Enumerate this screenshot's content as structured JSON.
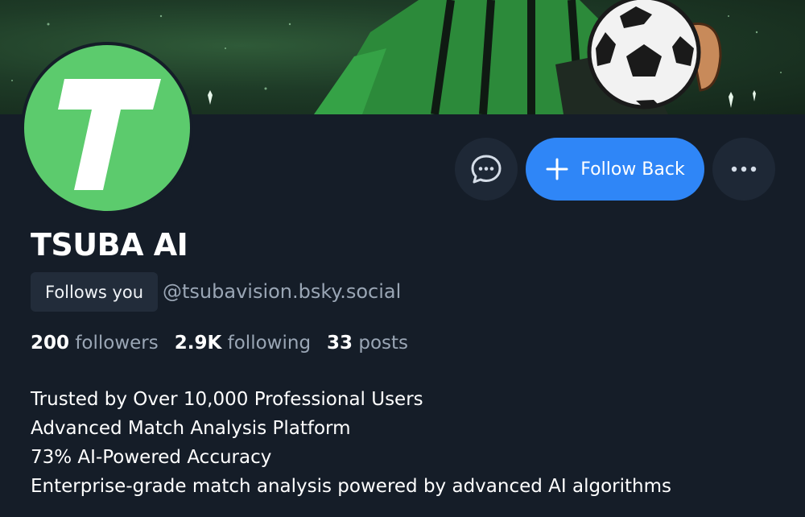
{
  "profile": {
    "display_name": "TSUBA AI",
    "avatar_letter": "T",
    "follows_you_label": "Follows you",
    "handle": "@tsubavision.bsky.social",
    "colors": {
      "avatar_bg": "#5ccb6d",
      "accent": "#2f86f7",
      "page_bg": "#151d28"
    }
  },
  "actions": {
    "message_icon": "chat-bubble-icon",
    "follow_back_label": "Follow Back",
    "follow_icon": "plus-icon",
    "more_icon": "ellipsis-icon"
  },
  "stats": [
    {
      "value": "200",
      "label": "followers"
    },
    {
      "value": "2.9K",
      "label": "following"
    },
    {
      "value": "33",
      "label": "posts"
    }
  ],
  "bio": [
    "Trusted by Over 10,000 Professional Users",
    "Advanced Match Analysis Platform",
    "73% AI-Powered Accuracy",
    "Enterprise-grade match analysis powered by advanced AI algorithms"
  ]
}
